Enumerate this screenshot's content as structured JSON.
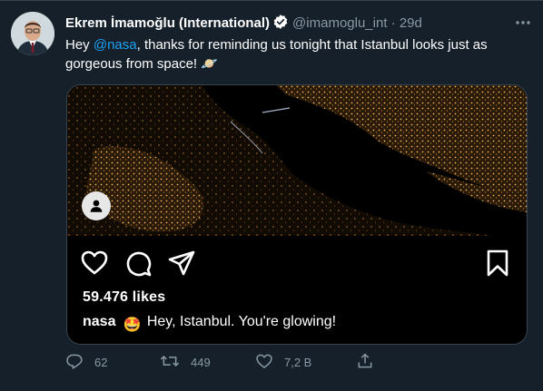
{
  "tweet": {
    "author_name": "Ekrem İmamoğlu (International)",
    "handle": "@imamoglu_int",
    "separator": "·",
    "time": "29d",
    "text_before": "Hey ",
    "mention": "@nasa",
    "text_after": ", thanks for reminding us tonight that Istanbul looks just as gorgeous from space! ",
    "text_emoji": "🪐",
    "icons": {
      "verified": "verified-badge-icon",
      "more": "more-icon"
    },
    "colors": {
      "background": "#15202b",
      "accent": "#1da1f2",
      "secondary_text": "#8899a6",
      "border": "#38444d"
    }
  },
  "embedded_post": {
    "likes": "59.476 likes",
    "caption_user": "nasa",
    "caption_emoji": "🤩",
    "caption_text": "Hey, Istanbul. You're glowing!",
    "icons": [
      "heart-icon",
      "comment-icon",
      "share-icon",
      "bookmark-icon",
      "user-tag-icon"
    ]
  },
  "actions": {
    "reply_count": "62",
    "retweet_count": "449",
    "like_count": "7,2 B",
    "icons": [
      "reply-icon",
      "retweet-icon",
      "like-icon",
      "share-icon"
    ]
  }
}
